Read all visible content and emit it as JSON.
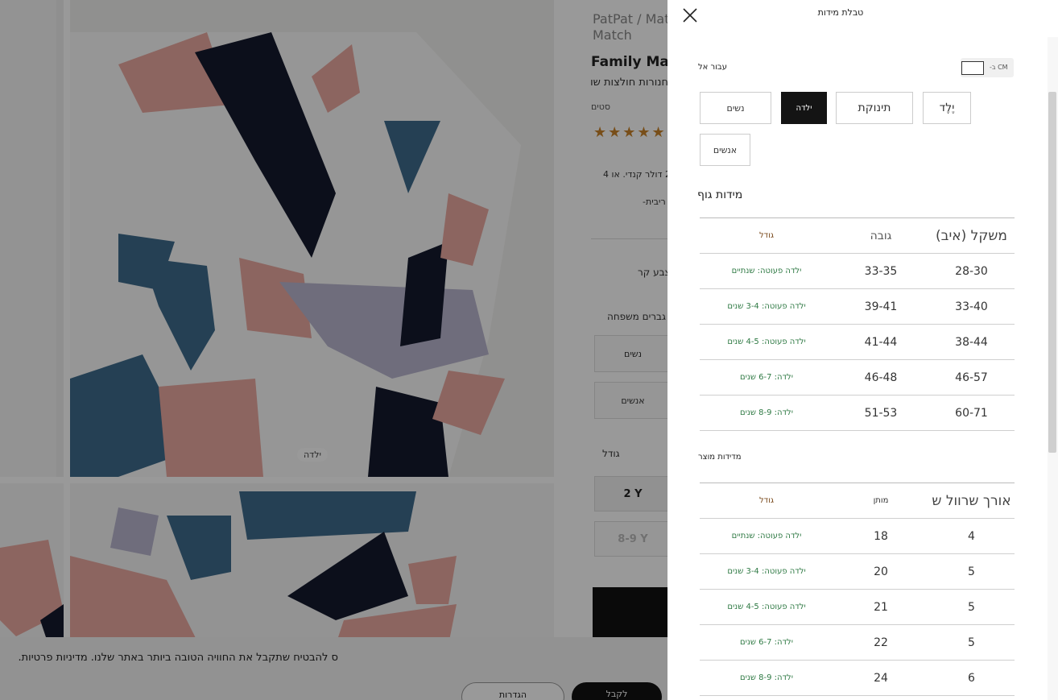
{
  "background_page": {
    "breadcrumb": "PatPat / Mat Family Match",
    "product_title": "Family Ma",
    "product_subtitle": "חנורות חולצות שו",
    "sold_label": "סטים",
    "price_text": "28 דולר קנדי. או 4",
    "interest_text": "ן ריבית-",
    "color_label": "צבע קר",
    "family_label": "גברים משפחה",
    "family_options": [
      "נשים",
      "אנשים"
    ],
    "size_label": "גודל",
    "size_options": [
      "2 Y",
      "8-9 Y"
    ],
    "photo_label": "ילדה",
    "cookie_text": "ס להבטיח שתקבל את החוויה הטובה ביותר באתר שלנו. מדיניות פרטיות.",
    "cookie_accept": "לקבל",
    "cookie_settings": "הגדרות"
  },
  "drawer": {
    "title": "טבלת מידות",
    "for_label": "עבור אל",
    "unit_label": "CM ב-",
    "tabs": {
      "women": "נשים",
      "girl": "ילדה",
      "baby": "תינוקת",
      "boy": "יֶלֶד",
      "men": "אנשים"
    },
    "active_tab": "girl",
    "body_title": "מידות גוף",
    "body_table": {
      "headers": {
        "size": "גודל",
        "height": "גובה",
        "weight": "משקל (איב)"
      },
      "rows": [
        {
          "size": "ילדה פעוטה: שנתיים",
          "height": "33-35",
          "weight": "28-30"
        },
        {
          "size": "ילדה פעוטה: 3-4 שנים",
          "height": "39-41",
          "weight": "33-40"
        },
        {
          "size": "ילדה פעוטה: 4-5 שנים",
          "height": "41-44",
          "weight": "38-44"
        },
        {
          "size": "ילדה: 6-7 שנים",
          "height": "46-48",
          "weight": "46-57"
        },
        {
          "size": "ילדה: 8-9 שנים",
          "height": "51-53",
          "weight": "60-71"
        }
      ]
    },
    "product_title": "מדידות מוצר",
    "product_table": {
      "headers": {
        "size": "גודל",
        "waist": "מותן",
        "sleeve": "אורך שרוול ש"
      },
      "rows": [
        {
          "size": "ילדה פעוטה: שנתיים",
          "waist": "18",
          "sleeve": "4"
        },
        {
          "size": "ילדה פעוטה: 3-4 שנים",
          "waist": "20",
          "sleeve": "5"
        },
        {
          "size": "ילדה פעוטה: 4-5 שנים",
          "waist": "21",
          "sleeve": "5"
        },
        {
          "size": "ילדה: 6-7 שנים",
          "waist": "22",
          "sleeve": "5"
        },
        {
          "size": "ילדה: 8-9 שנים",
          "waist": "24",
          "sleeve": "6"
        }
      ]
    }
  },
  "icons": {
    "close": "close-icon",
    "star": "star-icon"
  },
  "colors": {
    "overlay": "rgba(0,0,0,0.4)",
    "active_tab": "#141414",
    "size_green": "#2f7a44",
    "star": "#c8832a"
  }
}
